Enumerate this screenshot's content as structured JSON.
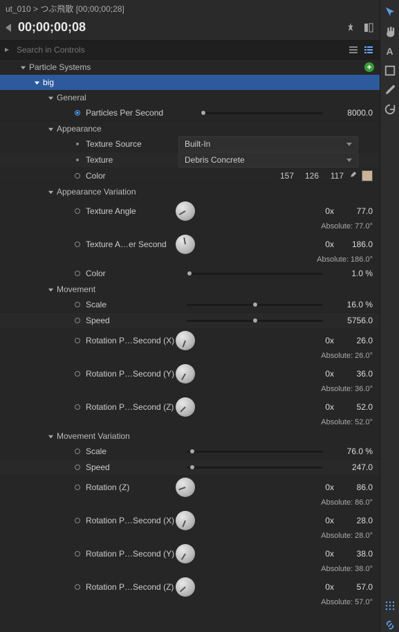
{
  "breadcrumb": "ut_010 > つぶ飛散 [00;00;00;28]",
  "timecode": "00;00;00;08",
  "search": {
    "placeholder": "Search in Controls"
  },
  "root": {
    "label": "Particle Systems"
  },
  "system": {
    "name": "big"
  },
  "sections": {
    "general": {
      "label": "General",
      "pps": {
        "label": "Particles Per Second",
        "value": "8000.0"
      }
    },
    "appearance": {
      "label": "Appearance",
      "textureSource": {
        "label": "Texture Source",
        "value": "Built-In"
      },
      "texture": {
        "label": "Texture",
        "value": "Debris Concrete"
      },
      "color": {
        "label": "Color",
        "r": "157",
        "g": "126",
        "b": "117"
      }
    },
    "appearanceVar": {
      "label": "Appearance Variation",
      "textureAngle": {
        "label": "Texture Angle",
        "mult": "0x",
        "val": "77.0",
        "abs": "Absolute: 77.0°"
      },
      "textureAnglePerSec": {
        "label": "Texture A…er Second",
        "mult": "0x",
        "val": "186.0",
        "abs": "Absolute: 186.0°"
      },
      "color": {
        "label": "Color",
        "val": "1.0 %"
      }
    },
    "movement": {
      "label": "Movement",
      "scale": {
        "label": "Scale",
        "val": "16.0 %"
      },
      "speed": {
        "label": "Speed",
        "val": "5756.0"
      },
      "rotX": {
        "label": "Rotation P…Second (X)",
        "mult": "0x",
        "val": "26.0",
        "abs": "Absolute: 26.0°"
      },
      "rotY": {
        "label": "Rotation P…Second (Y)",
        "mult": "0x",
        "val": "36.0",
        "abs": "Absolute: 36.0°"
      },
      "rotZ": {
        "label": "Rotation P…Second (Z)",
        "mult": "0x",
        "val": "52.0",
        "abs": "Absolute: 52.0°"
      }
    },
    "movementVar": {
      "label": "Movement Variation",
      "scale": {
        "label": "Scale",
        "val": "76.0 %"
      },
      "speed": {
        "label": "Speed",
        "val": "247.0"
      },
      "rotationZ": {
        "label": "Rotation (Z)",
        "mult": "0x",
        "val": "86.0",
        "abs": "Absolute: 86.0°"
      },
      "rotX": {
        "label": "Rotation P…Second (X)",
        "mult": "0x",
        "val": "28.0",
        "abs": "Absolute: 28.0°"
      },
      "rotY": {
        "label": "Rotation P…Second (Y)",
        "mult": "0x",
        "val": "38.0",
        "abs": "Absolute: 38.0°"
      },
      "rotZ": {
        "label": "Rotation P…Second (Z)",
        "mult": "0x",
        "val": "57.0",
        "abs": "Absolute: 57.0°"
      }
    }
  }
}
